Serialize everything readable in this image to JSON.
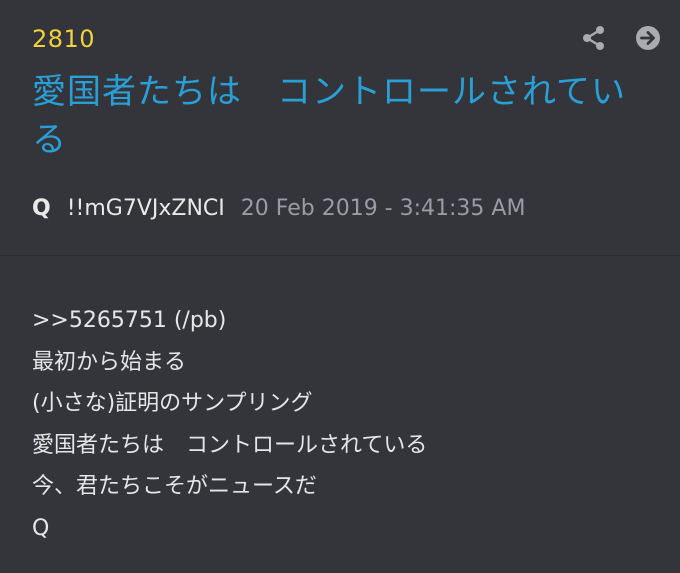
{
  "post": {
    "number": "2810",
    "title": "愛国者たちは　コントロールされている",
    "author": "Q",
    "tripcode": "!!mG7VJxZNCI",
    "timestamp": "20 Feb 2019 - 3:41:35 AM",
    "reference": ">>5265751 (/pb)",
    "lines": [
      "最初から始まる",
      "(小さな)証明のサンプリング",
      "愛国者たちは　コントロールされている",
      "今、君たちこそがニュースだ",
      "Q"
    ]
  },
  "icons": {
    "share": "share-icon",
    "go": "arrow-right-circle-icon"
  },
  "colors": {
    "background": "#33353b",
    "post_number": "#f0d23c",
    "title": "#2a9fd6",
    "text": "#e6e6e8",
    "timestamp": "#9a9ca3",
    "icon": "#a9abb1"
  }
}
